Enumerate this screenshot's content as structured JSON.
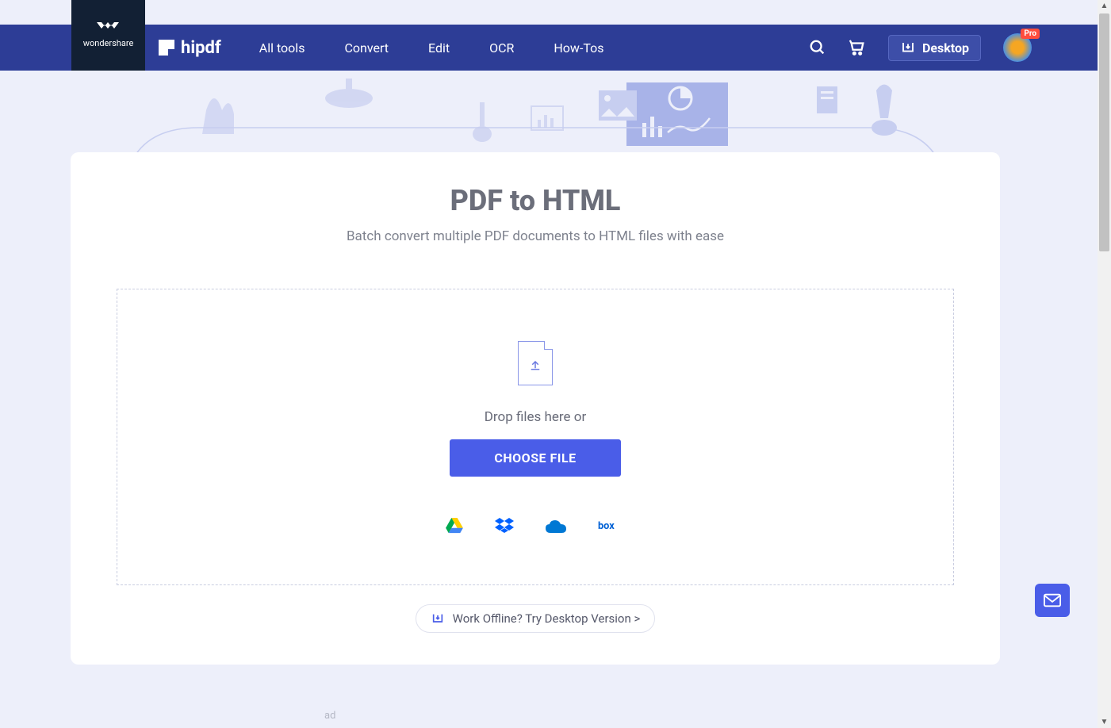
{
  "brand": {
    "wondershare": "wondershare",
    "product": "hipdf"
  },
  "nav": {
    "items": [
      "All tools",
      "Convert",
      "Edit",
      "OCR",
      "How-Tos"
    ],
    "desktop_label": "Desktop",
    "pro_badge": "Pro"
  },
  "page": {
    "title": "PDF to HTML",
    "subtitle": "Batch convert multiple PDF documents to HTML files with ease"
  },
  "drop": {
    "text": "Drop files here or",
    "button": "CHOOSE FILE"
  },
  "cloud": {
    "drive": "Google Drive",
    "dropbox": "Dropbox",
    "onedrive": "OneDrive",
    "box": "box"
  },
  "offline": {
    "text": "Work Offline? Try Desktop Version >"
  },
  "misc": {
    "ad": "ad"
  }
}
